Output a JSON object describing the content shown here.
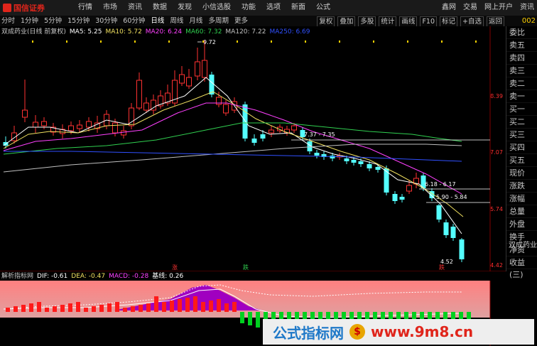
{
  "header": {
    "brand": "国信证券",
    "menu": [
      "行情",
      "市场",
      "资讯",
      "数据",
      "发现",
      "小信选股",
      "功能",
      "选项",
      "新面",
      "公式"
    ],
    "right_links": [
      "鑫网",
      "交易",
      "网上开户",
      "资讯"
    ]
  },
  "period_bar": {
    "periods": [
      "分时",
      "1分钟",
      "5分钟",
      "15分钟",
      "30分钟",
      "60分钟",
      "日线",
      "周线",
      "月线",
      "多周期",
      "更多"
    ],
    "active": "日线",
    "tools": [
      "复权",
      "叠加",
      "多股",
      "统计",
      "画线",
      "F10",
      "标记",
      "+自选",
      "返回"
    ],
    "stock_code": "002"
  },
  "info_line": {
    "name": "双成药业(日线 前复权)",
    "ma": [
      {
        "label": "MA5: 5.25",
        "color": "#ffffff"
      },
      {
        "label": "MA10: 5.72",
        "color": "#f0e060"
      },
      {
        "label": "MA20: 6.24",
        "color": "#ff40ff"
      },
      {
        "label": "MA60: 7.32",
        "color": "#30d050"
      },
      {
        "label": "MA120: 7.22",
        "color": "#c0c0c0"
      },
      {
        "label": "MA250: 6.69",
        "color": "#3050ff"
      }
    ]
  },
  "side_panel": {
    "rows": [
      "委比",
      "卖五",
      "卖四",
      "卖三",
      "卖二",
      "卖一",
      "买一",
      "买二",
      "买三",
      "买四",
      "买五",
      "现价",
      "涨跌",
      "涨幅",
      "总量",
      "外盘",
      "换手",
      "净资",
      "收益(三)"
    ],
    "stock_name": "双成药业"
  },
  "price_axis": {
    "ticks": [
      "8.39",
      "7.07",
      "5.74",
      "4.42"
    ]
  },
  "annotations": {
    "high_label": "9.72",
    "low_label": "4.52",
    "gap_labels": [
      "7.37 - 7.35",
      "6.18 - 6.17",
      "5.90 - 5.84"
    ],
    "markers": [
      "涨",
      "跌",
      "跌"
    ]
  },
  "indicator": {
    "name": "解析指标网",
    "values": [
      {
        "label": "DIF: -0.61",
        "color": "#ffffff"
      },
      {
        "label": "DEA: -0.47",
        "color": "#f0e060"
      },
      {
        "label": "MACD: -0.28",
        "color": "#ff40ff"
      },
      {
        "label": "基线: 0.26",
        "color": "#ffffff"
      }
    ]
  },
  "watermark": {
    "left": "公式指标网",
    "coin": "$",
    "right": "www.9m8.cn"
  },
  "colors": {
    "up": "#ff3232",
    "down": "#54ffff",
    "ma5": "#ffffff",
    "ma10": "#f0e060",
    "ma20": "#ff40ff",
    "ma60": "#30d050",
    "ma120": "#c0c0c0",
    "ma250": "#3050ff",
    "brand": "#e0251b"
  }
}
